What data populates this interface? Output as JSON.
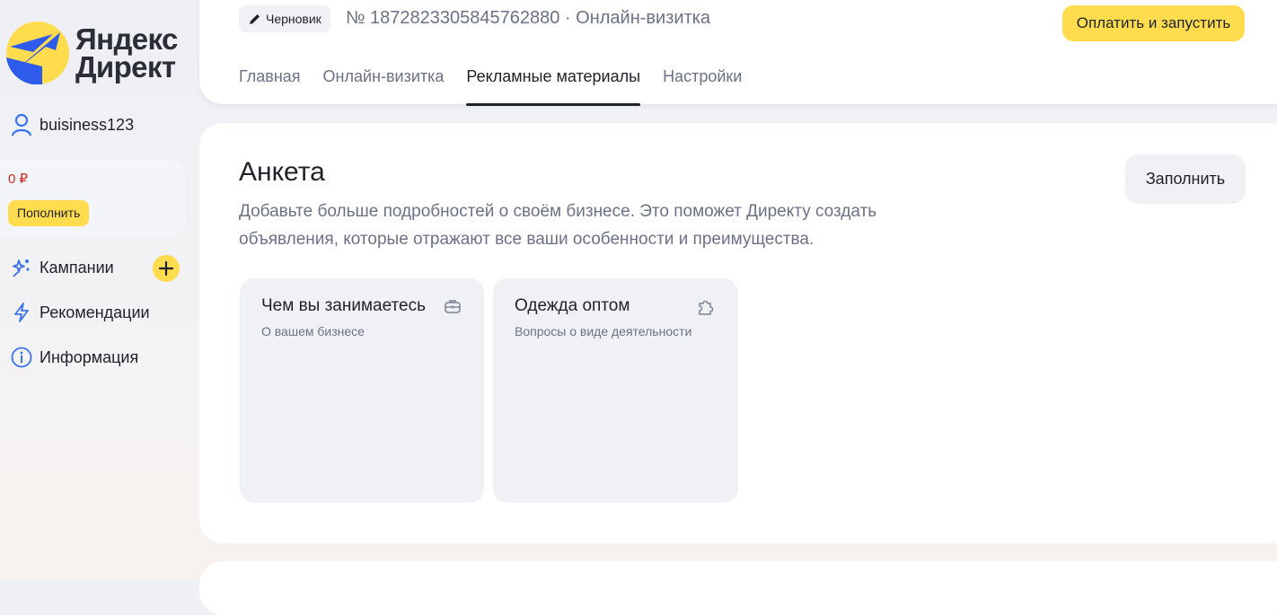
{
  "brand": {
    "line1": "Яндекс",
    "line2": "Директ",
    "colors": {
      "yellow": "#ffdc4d",
      "blue": "#2f5bea"
    }
  },
  "sidebar": {
    "username": "buisiness123",
    "balance": "0 ₽",
    "topup_label": "Пополнить",
    "items": [
      {
        "label": "Кампании",
        "icon": "campaigns-sparkle-icon"
      },
      {
        "label": "Рекомендации",
        "icon": "lightning-icon"
      },
      {
        "label": "Информация",
        "icon": "info-icon"
      }
    ]
  },
  "header": {
    "status": "Черновик",
    "campaign_number": "№ 1872823305845762880",
    "separator": "·",
    "campaign_type": "Онлайн-визитка",
    "launch_label": "Оплатить и запустить",
    "tabs": [
      {
        "label": "Главная",
        "active": false
      },
      {
        "label": "Онлайн-визитка",
        "active": false
      },
      {
        "label": "Рекламные материалы",
        "active": true
      },
      {
        "label": "Настройки",
        "active": false
      }
    ]
  },
  "main": {
    "title": "Анкета",
    "description": "Добавьте больше подробностей о своём бизнесе. Это поможет Директу создать объявления, которые отражают все ваши особенности и преимущества.",
    "fill_label": "Заполнить",
    "tiles": [
      {
        "title": "Чем вы занимаетесь",
        "subtitle": "О вашем бизнесе",
        "icon": "briefcase-icon"
      },
      {
        "title": "Одежда оптом",
        "subtitle": "Вопросы о виде деятельности",
        "icon": "puzzle-icon"
      }
    ]
  }
}
